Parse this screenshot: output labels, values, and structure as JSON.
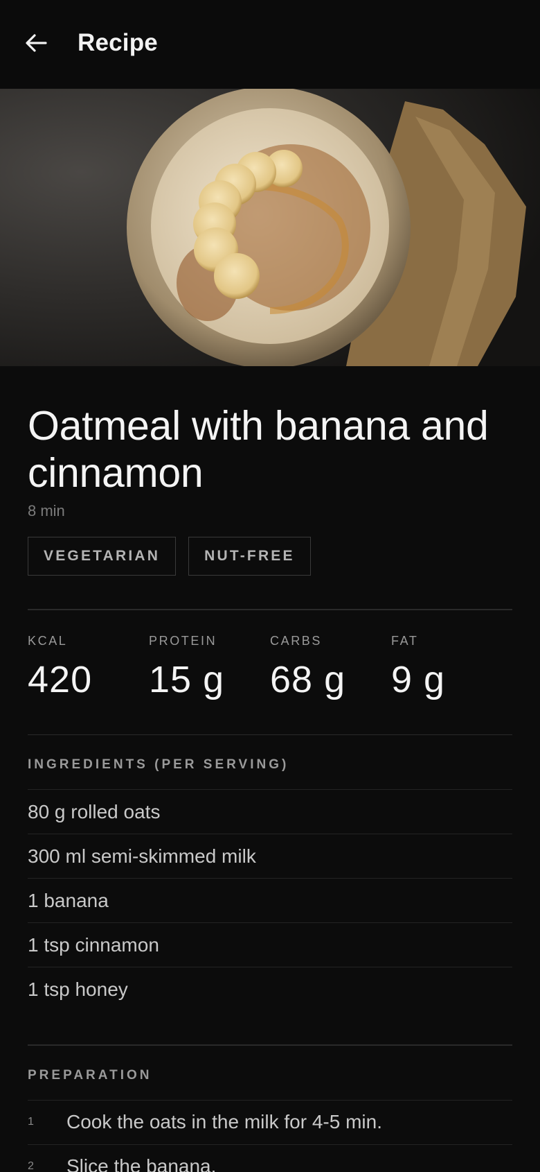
{
  "appbar": {
    "back_icon": "arrow-left-icon",
    "title": "Recipe"
  },
  "hero": {
    "image_description": "Bowl of oatmeal with banana slices, cinnamon and honey on a dark slate with a tan napkin"
  },
  "recipe": {
    "title": "Oatmeal with banana and cinnamon",
    "duration": "8 min",
    "tags": [
      "VEGETARIAN",
      "NUT-FREE"
    ]
  },
  "nutrition": [
    {
      "label": "KCAL",
      "value": "420"
    },
    {
      "label": "PROTEIN",
      "value": "15 g"
    },
    {
      "label": "CARBS",
      "value": "68 g"
    },
    {
      "label": "FAT",
      "value": "9 g"
    }
  ],
  "ingredients": {
    "title": "INGREDIENTS (PER SERVING)",
    "items": [
      "80 g rolled oats",
      "300 ml semi-skimmed milk",
      "1 banana",
      "1 tsp cinnamon",
      "1 tsp honey"
    ]
  },
  "preparation": {
    "title": "PREPARATION",
    "steps": [
      {
        "num": "1",
        "text": "Cook the oats in the milk for 4-5 min."
      },
      {
        "num": "2",
        "text": "Slice the banana."
      }
    ]
  },
  "colors": {
    "background": "#0c0c0c",
    "text_primary": "#f4f4f4",
    "text_secondary": "#9a9a9a",
    "divider": "#2a2a2a"
  }
}
